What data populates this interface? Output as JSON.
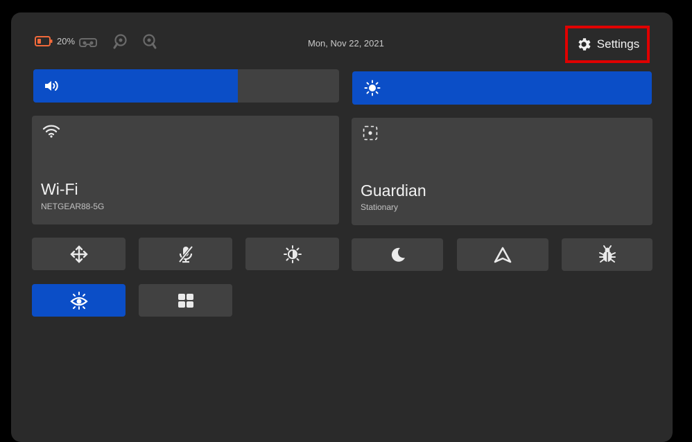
{
  "status": {
    "battery_percent": "20%",
    "date": "Mon, Nov 22, 2021",
    "icons": [
      "battery-icon",
      "headset-icon",
      "controller-left-icon",
      "controller-right-icon"
    ],
    "battery_color": "#f26a3b"
  },
  "settings": {
    "label": "Settings",
    "highlight_color": "#e00000"
  },
  "volume": {
    "icon": "volume-icon",
    "level": 0.67
  },
  "brightness": {
    "icon": "brightness-icon",
    "level": 1.0
  },
  "wifi": {
    "title": "Wi-Fi",
    "network": "NETGEAR88-5G",
    "icon": "wifi-icon"
  },
  "guardian": {
    "title": "Guardian",
    "mode": "Stationary",
    "icon": "guardian-icon"
  },
  "quick_actions": [
    {
      "name": "move-button",
      "icon": "move-icon",
      "active": false
    },
    {
      "name": "mic-mute-button",
      "icon": "mic-muted-icon",
      "active": false
    },
    {
      "name": "display-button",
      "icon": "contrast-sun-icon",
      "active": false
    },
    {
      "name": "night-mode-button",
      "icon": "moon-icon",
      "active": false
    },
    {
      "name": "cast-button",
      "icon": "triangle-icon",
      "active": false
    },
    {
      "name": "bug-report-button",
      "icon": "bug-icon",
      "active": false
    },
    {
      "name": "passthrough-button",
      "icon": "eye-icon",
      "active": true
    },
    {
      "name": "apps-button",
      "icon": "grid-icon",
      "active": false
    }
  ],
  "colors": {
    "accent": "#0b4ec7",
    "panel": "#2a2a2a",
    "tile": "#414141"
  }
}
